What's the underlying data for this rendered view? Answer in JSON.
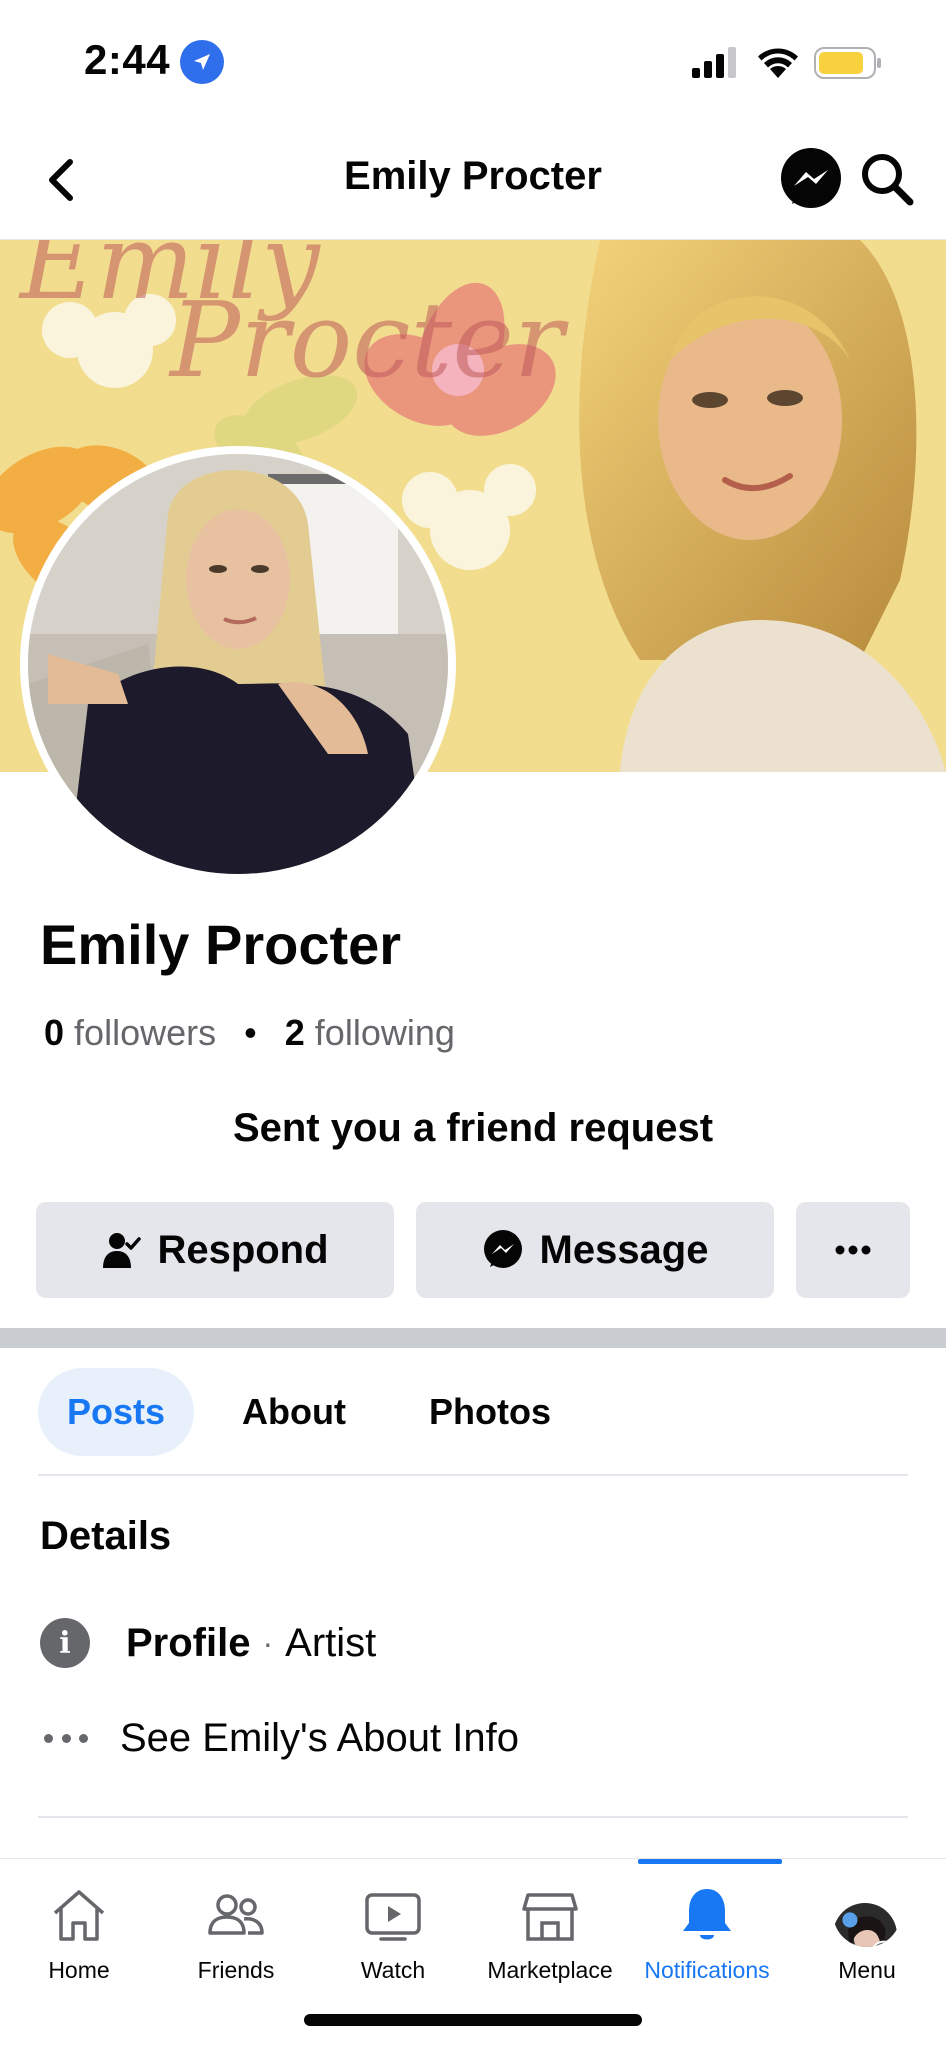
{
  "status_bar": {
    "time": "2:44"
  },
  "nav": {
    "title": "Emily Procter"
  },
  "cover": {
    "line1": "Emily",
    "line2": "Procter"
  },
  "profile": {
    "name": "Emily Procter",
    "followers_count": "0",
    "followers_label": "followers",
    "following_count": "2",
    "following_label": "following",
    "request_text": "Sent you a friend request"
  },
  "actions": {
    "respond_label": "Respond",
    "message_label": "Message",
    "more_label": "···"
  },
  "tabs": [
    {
      "label": "Posts",
      "active": true
    },
    {
      "label": "About",
      "active": false
    },
    {
      "label": "Photos",
      "active": false
    }
  ],
  "details": {
    "title": "Details",
    "profile_label": "Profile",
    "profile_separator": "·",
    "profile_value": "Artist",
    "about_link": "See Emily's About Info"
  },
  "tab_bar": {
    "items": [
      {
        "label": "Home",
        "icon": "home-icon"
      },
      {
        "label": "Friends",
        "icon": "friends-icon"
      },
      {
        "label": "Watch",
        "icon": "watch-icon"
      },
      {
        "label": "Marketplace",
        "icon": "marketplace-icon"
      },
      {
        "label": "Notifications",
        "icon": "bell-icon",
        "active": true
      },
      {
        "label": "Menu",
        "icon": "avatar"
      }
    ]
  },
  "colors": {
    "accent": "#1877f2",
    "button_bg": "#e4e6eb",
    "secondary_text": "#65676b",
    "cover_bg": "#f2dd8f"
  }
}
